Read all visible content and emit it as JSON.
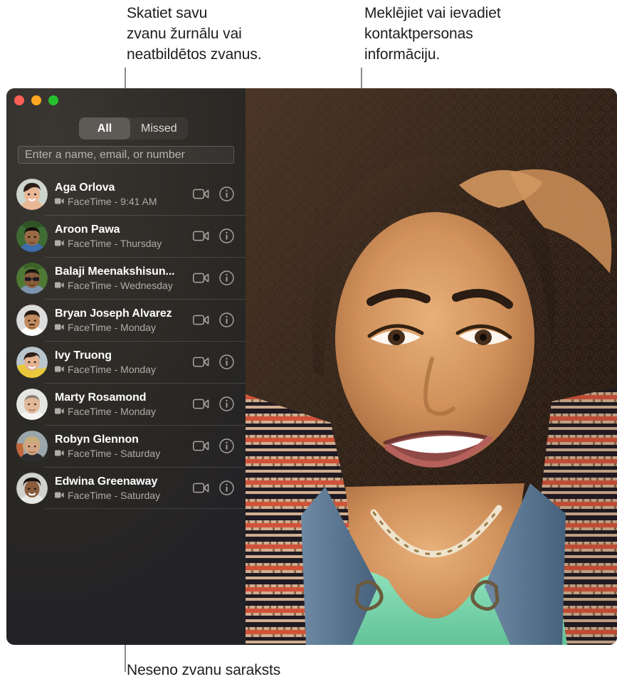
{
  "callouts": {
    "left": "Skatiet savu\nzvanu žurnālu vai\nneatbildētos zvanus.",
    "right": "Meklējiet vai ievadiet\nkontaktpersonas\ninformāciju.",
    "bottom": "Neseno zvanu saraksts"
  },
  "window": {
    "traffic_lights": [
      {
        "name": "close",
        "color": "#ff5f57"
      },
      {
        "name": "minimize",
        "color": "#ffa722"
      },
      {
        "name": "maximize",
        "color": "#25c22e"
      }
    ]
  },
  "sidebar": {
    "segmented_control": {
      "options": [
        "All",
        "Missed"
      ],
      "selected": "All"
    },
    "search": {
      "placeholder": "Enter a name, email, or number",
      "value": ""
    },
    "calls": [
      {
        "name": "Aga Orlova",
        "detail": "FaceTime - 9:41 AM",
        "avatar": {
          "skin": "#e8b896",
          "hair": "#2b1f18",
          "bg": "#cdd6cc",
          "type": "f1"
        }
      },
      {
        "name": "Aroon Pawa",
        "detail": "FaceTime - Thursday",
        "avatar": {
          "skin": "#9a6a45",
          "hair": "#150f0b",
          "bg": "#3f6b34",
          "type": "m1"
        }
      },
      {
        "name": "Balaji Meenakshisun...",
        "detail": "FaceTime - Wednesday",
        "avatar": {
          "skin": "#8a5c3c",
          "hair": "#1a1410",
          "bg": "#4f7a35",
          "type": "m2"
        }
      },
      {
        "name": "Bryan Joseph Alvarez",
        "detail": "FaceTime - Monday",
        "avatar": {
          "skin": "#c08a5e",
          "hair": "#2a1a12",
          "bg": "#dcdcdc",
          "type": "m3"
        }
      },
      {
        "name": "Ivy Truong",
        "detail": "FaceTime - Monday",
        "avatar": {
          "skin": "#e3b392",
          "hair": "#2e2018",
          "bg": "#b9c6cd",
          "type": "f2"
        }
      },
      {
        "name": "Marty Rosamond",
        "detail": "FaceTime - Monday",
        "avatar": {
          "skin": "#e2b89a",
          "hair": "#8e7f72",
          "bg": "#e5e5e3",
          "type": "m4"
        }
      },
      {
        "name": "Robyn Glennon",
        "detail": "FaceTime - Saturday",
        "avatar": {
          "skin": "#d2a582",
          "hair": "#c8ad7d",
          "bg": "#9aa6ab",
          "type": "f3"
        }
      },
      {
        "name": "Edwina Greenaway",
        "detail": "FaceTime - Saturday",
        "avatar": {
          "skin": "#8a5c3e",
          "hair": "#1b1310",
          "bg": "#cfd2cd",
          "type": "f4"
        }
      }
    ],
    "row_action_labels": {
      "video": "Start video call",
      "info": "Show call details"
    }
  },
  "photo": {
    "description": "Smiling woman with curly hair, green tank top, denim overalls and beaded necklace",
    "colors": {
      "hair": "#3a2b1e",
      "skin": "#d79a63",
      "top": "#7fd8ae",
      "denim": "#5a7a96",
      "blanket_red": "#d8543a",
      "background": "#2a1d13"
    }
  }
}
